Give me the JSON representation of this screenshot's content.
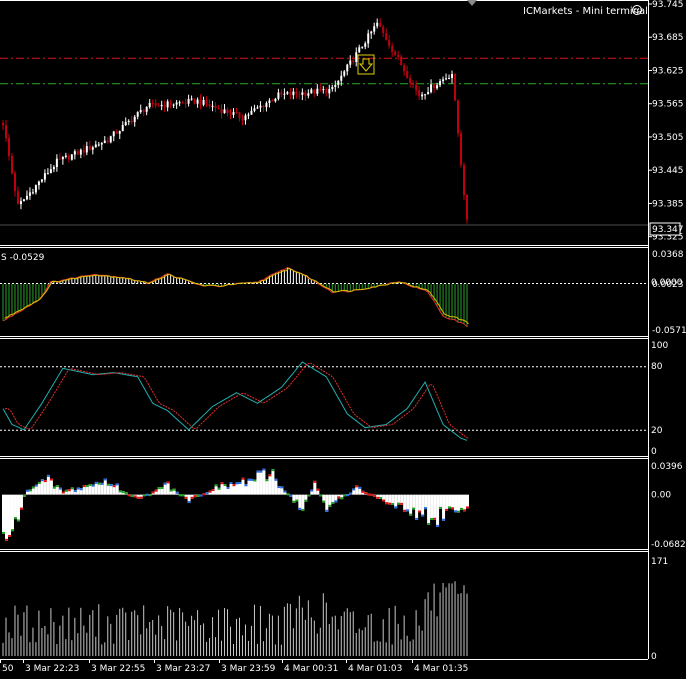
{
  "terminal_title": "ICMarkets - Mini terminal",
  "current_price": "93.347",
  "time_labels": [
    "50",
    "3 Mar 22:23",
    "3 Mar 22:55",
    "3 Mar 23:27",
    "3 Mar 23:59",
    "4 Mar 00:31",
    "4 Mar 01:03",
    "4 Mar 01:35"
  ],
  "colors": {
    "background": "#000000",
    "bull_candle": "#ffffff",
    "bear_candle": "#c0000f",
    "resistance_line": "#e01010",
    "support_line": "#20b020",
    "osc_positive": "#ffffff",
    "osc_negative": "#2aa02a",
    "stoch_main": "#20b0b0",
    "stoch_signal": "#e03030",
    "volume": "#c8c8c8",
    "arrow_marker": "#e0d000"
  },
  "panels": {
    "price": {
      "axis_labels": [
        "93.745",
        "93.685",
        "93.625",
        "93.565",
        "93.505",
        "93.445",
        "93.385",
        "93.325"
      ],
      "axis_range": [
        93.319,
        93.745
      ],
      "resistance_level": 93.648,
      "support_level": 93.602,
      "current_value": 93.347
    },
    "oscillator": {
      "header": "S -0.0529",
      "axis_labels": [
        "0.0368",
        "0.0000",
        "-0.0571"
      ],
      "zero_label_overlap": "0.0023",
      "axis_range": [
        -0.0571,
        0.0368
      ]
    },
    "stochastic": {
      "axis_labels": [
        "100",
        "80",
        "20",
        "0"
      ],
      "levels": [
        80,
        20
      ],
      "axis_range": [
        0,
        100
      ]
    },
    "histogram": {
      "axis_labels": [
        "0.0396",
        "0.00",
        "-0.0682"
      ],
      "axis_range": [
        -0.0682,
        0.0396
      ]
    },
    "volume": {
      "axis_labels": [
        "171",
        "0"
      ],
      "axis_range": [
        0,
        171
      ]
    }
  },
  "chart_data": {
    "type": "line",
    "x": [
      "50",
      "3 Mar 22:23",
      "3 Mar 22:55",
      "3 Mar 23:27",
      "3 Mar 23:59",
      "4 Mar 00:31",
      "4 Mar 01:03",
      "4 Mar 01:35"
    ],
    "series": [
      {
        "values": [
          93.4,
          93.49,
          93.56,
          93.59,
          93.58,
          93.71,
          93.58,
          93.35
        ]
      }
    ],
    "ylim": [
      93.319,
      93.745
    ]
  }
}
